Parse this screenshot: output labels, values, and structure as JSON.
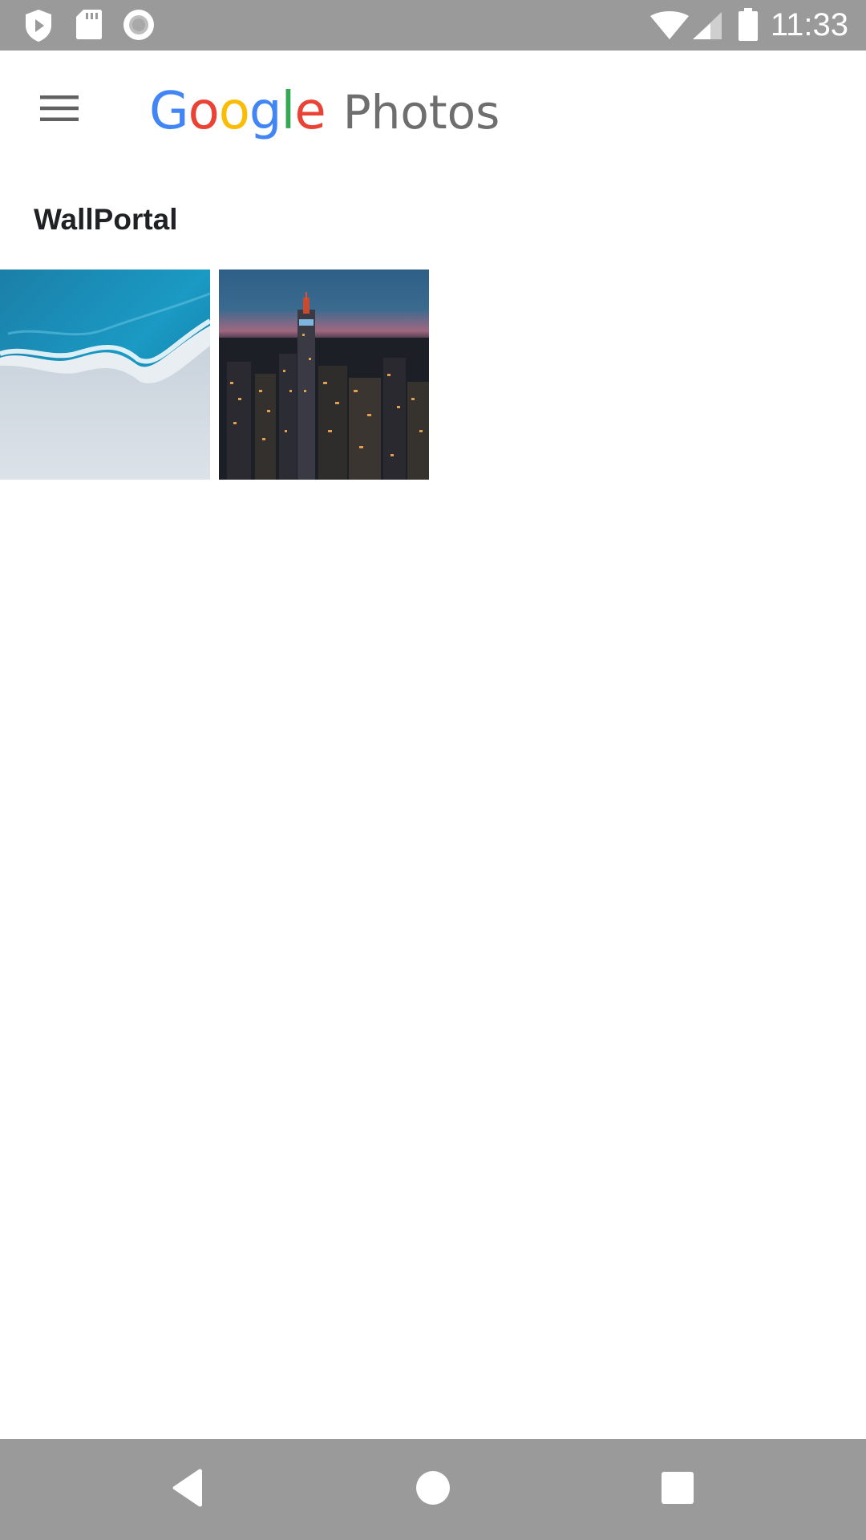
{
  "status_bar": {
    "time": "11:33",
    "left_icons": [
      "shield-play-icon",
      "sd-card-icon",
      "record-icon"
    ],
    "right_icons": [
      "wifi-icon",
      "cell-signal-icon",
      "battery-icon"
    ],
    "color": "#9a9a9a"
  },
  "app_bar": {
    "menu_icon": "hamburger-menu-icon",
    "logo": {
      "letters": [
        "G",
        "o",
        "o",
        "g",
        "l",
        "e"
      ],
      "letter_colors": [
        "#4285F4",
        "#EA4335",
        "#FBBC05",
        "#4285F4",
        "#34A853",
        "#EA4335"
      ],
      "product": "Photos"
    }
  },
  "album": {
    "title": "WallPortal",
    "photos": [
      {
        "name": "ocean-shore-aerial",
        "description_icon": "photo-thumbnail"
      },
      {
        "name": "city-night-skyline",
        "description_icon": "photo-thumbnail"
      }
    ]
  },
  "nav_bar": {
    "buttons": [
      "back-icon",
      "home-icon",
      "recents-icon"
    ],
    "color": "#9a9a9a"
  }
}
